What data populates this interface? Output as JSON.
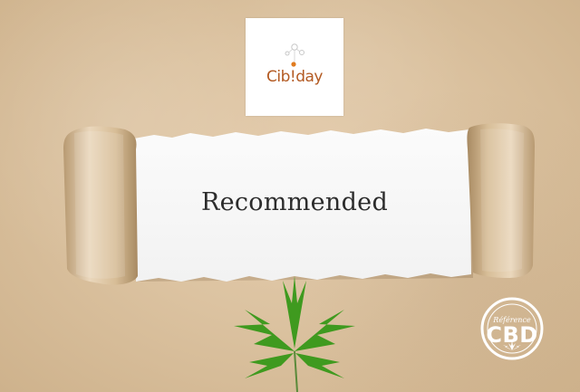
{
  "logo": {
    "text": "Cib!day",
    "icon": "molecule-icon"
  },
  "banner": {
    "text": "Recommended"
  },
  "leaf": {
    "icon": "cannabis-leaf-icon",
    "color": "#3f9a1f"
  },
  "badge": {
    "top_text": "Référence",
    "main_text": "CBD",
    "icon": "small-leaf-icon"
  },
  "colors": {
    "paper": "#dcc3a1",
    "logo_brand": "#b35a22"
  }
}
